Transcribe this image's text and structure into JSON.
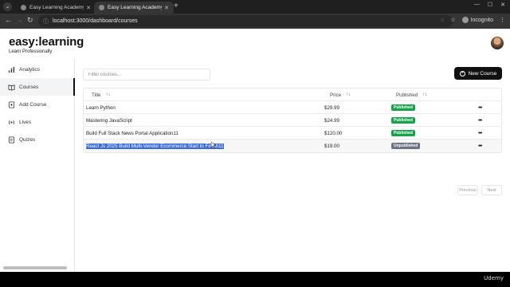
{
  "browser": {
    "tabs": [
      {
        "title": "Easy Learning Academy - Best"
      },
      {
        "title": "Easy Learning Academy - Best"
      }
    ],
    "url": "localhost:3000/dashboard/courses",
    "incognito_label": "Incognito"
  },
  "brand": {
    "name": "easy:learning",
    "tagline": "Learn Professionally"
  },
  "sidebar": {
    "items": [
      {
        "label": "Analytics",
        "icon": "bar-chart-icon"
      },
      {
        "label": "Courses",
        "icon": "book-icon",
        "active": true
      },
      {
        "label": "Add Course",
        "icon": "book-plus-icon"
      },
      {
        "label": "Lives",
        "icon": "radio-icon"
      },
      {
        "label": "Quizes",
        "icon": "quiz-icon"
      }
    ]
  },
  "main": {
    "filter_placeholder": "Filter courses...",
    "new_course_label": "New Course",
    "table": {
      "headers": {
        "title": "Title",
        "price": "Price",
        "published": "Published"
      },
      "rows": [
        {
          "title": "Learn Python",
          "price": "$29.99",
          "status": "Published"
        },
        {
          "title": "Mastering JavaScript",
          "price": "$24.99",
          "status": "Published"
        },
        {
          "title": "Build Full Stack News Portal Application11",
          "price": "$120.00",
          "status": "Published"
        },
        {
          "title": "React Js 2025 Build Multi-Vendor Ecommerce Start to Finish11",
          "price": "$19.00",
          "status": "Unpublished"
        }
      ]
    },
    "pagination": {
      "previous": "Previous",
      "next": "Next"
    }
  },
  "watermark": "Udemy",
  "colors": {
    "published": "#16a34a",
    "unpublished": "#6b7280",
    "selection": "#3b6bd6"
  }
}
